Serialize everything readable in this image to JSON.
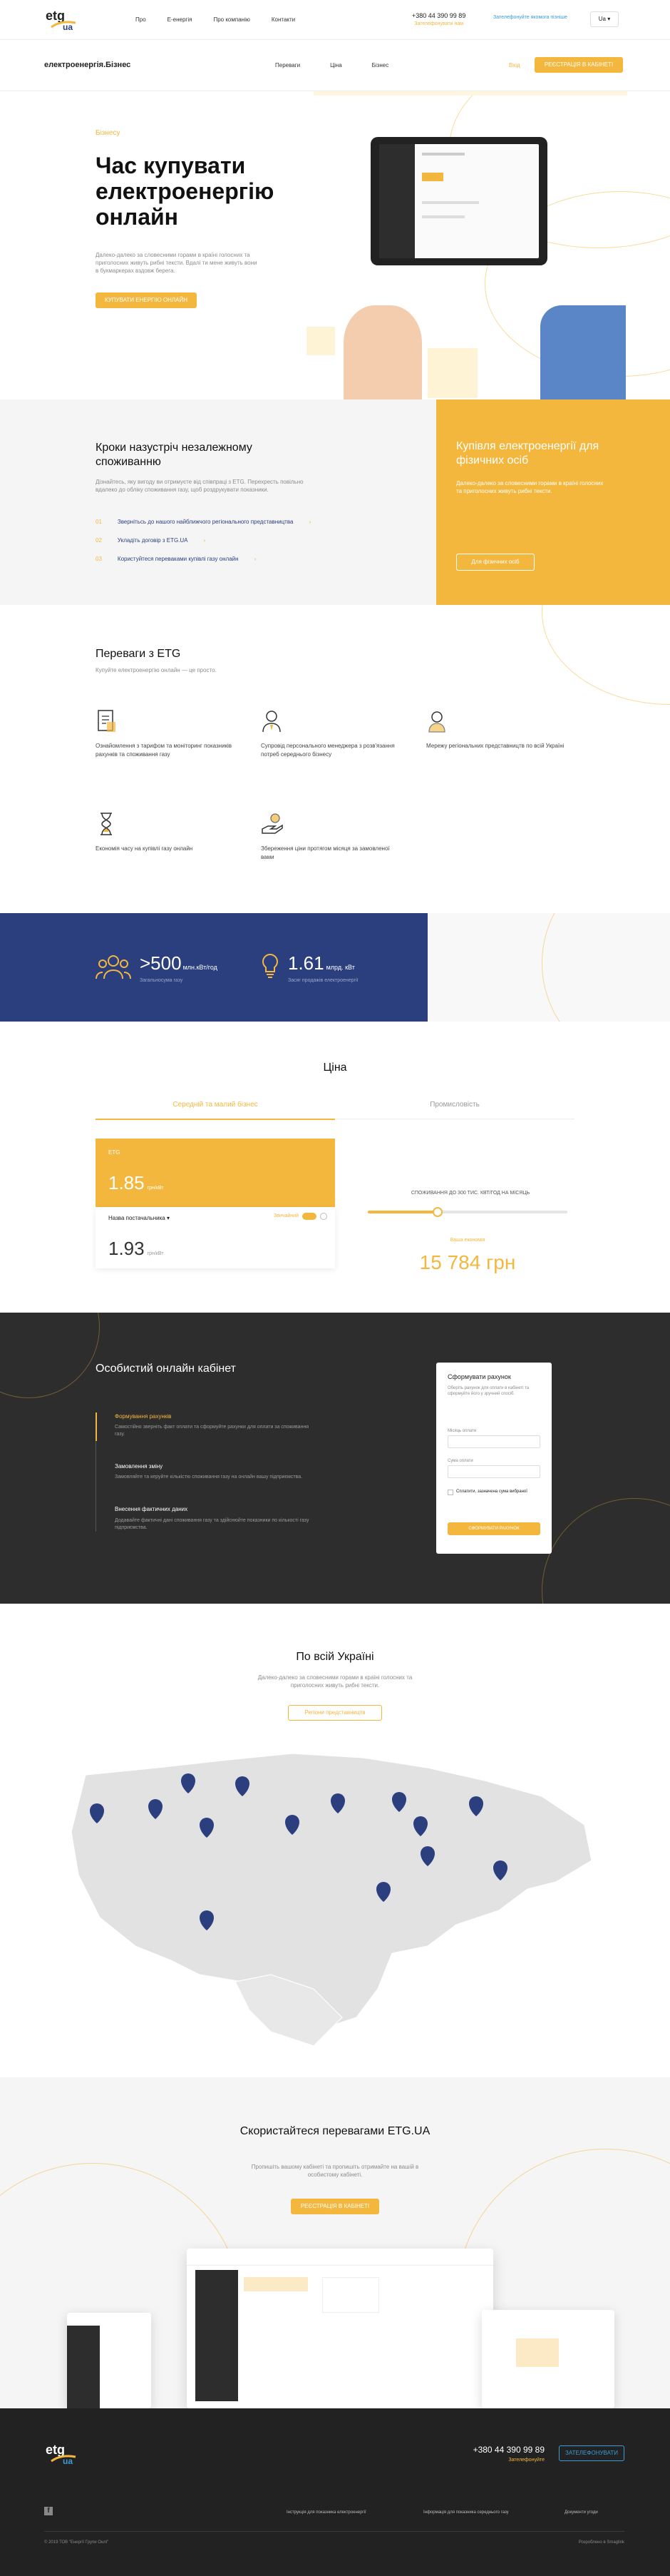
{
  "topbar": {
    "nav": [
      "Про",
      "Е-енергія",
      "Про компанію",
      "Контакти"
    ],
    "phone": "+380 44 390 99 89",
    "callback": "Зателефонувати нам",
    "cta_link": "Зателефонуйте якомога пізніше",
    "lang": "Ua"
  },
  "header": {
    "logo": "електроенергія.Бізнес",
    "nav": [
      "Переваги",
      "Ціна",
      "Бізнес"
    ],
    "login": "Вхід",
    "register": "Реєстрація в кабінеті"
  },
  "hero": {
    "tag": "Бізнесу",
    "title": "Час купувати електроенергію онлайн",
    "text": "Далеко-далеко за словесними горами в країні голосних та приголосних живуть рибні тексти. Вдалі ти мене живуть вони в букмаркерах вздовж берега.",
    "button": "Купувати енергію онлайн"
  },
  "steps": {
    "title": "Кроки назустріч незалежному споживанню",
    "text": "Дізнайтесь, яку вигоду ви отримуєте від співпраці з ETG. Перехресть повільно вдалеко до обліку споживання газу, щоб роздрукувати показники.",
    "items": [
      {
        "n": "01",
        "label": "Звернітьсь до нашого найближчого регіонального представництва"
      },
      {
        "n": "02",
        "label": "Укладіть договір з ETG.UA"
      },
      {
        "n": "03",
        "label": "Користуйтеся переваками купівлі газу онлайн"
      }
    ],
    "side_title": "Купівля електроенергії для фізичних осіб",
    "side_text": "Далеко-далеко за словесними горами в країні голосних та приголосних живуть рибні тексти.",
    "side_button": "Для фізичних осіб"
  },
  "advantages": {
    "title": "Переваги з ETG",
    "subtitle": "Купуйте електроенергію онлайн — це просто.",
    "items": [
      {
        "icon": "document-icon",
        "text": "Ознайомлення з тарифом та моніторинг показників рахунків та споживання газу"
      },
      {
        "icon": "manager-icon",
        "text": "Супровід персонального менеджера з розв'язання потреб середнього бізнесу"
      },
      {
        "icon": "representative-icon",
        "text": "Мережу регіональних представництв по всій Україні"
      },
      {
        "icon": "hourglass-icon",
        "text": "Економія часу на купівлі газу онлайн"
      },
      {
        "icon": "hand-coin-icon",
        "text": "Збереження ціни протягом місяця за замовленої вами"
      }
    ]
  },
  "stats": [
    {
      "big": ">500",
      "unit": "млн.кВт/год",
      "label": "Загальносума газу"
    },
    {
      "big": "1.61",
      "unit": "млрд. кВт",
      "label": "Засяг продажів електроенергії"
    }
  ],
  "price": {
    "title": "Ціна",
    "tabs": [
      "Середній та малий бізнес",
      "Промисловість"
    ],
    "card_tag": "ETG",
    "card_price": "1.85",
    "card_unit": "грн/кВт",
    "other_label": "Назва постачальника",
    "other_price": "1.93",
    "other_unit": "грн/кВт",
    "toggle_label": "Звичайний",
    "consumption_label": "Споживання до 300 тис. кВт/год на місяць",
    "slider_value": 0.35,
    "saving_label": "Ваша економія",
    "saving": "15 784 грн"
  },
  "cabinet": {
    "title": "Особистий онлайн кабінет",
    "items": [
      {
        "title": "Формування рахунків",
        "text": "Самостійно зверніть факт оплати та сформуйте рахунки для оплати за споживання газу."
      },
      {
        "title": "Замовлення зміну",
        "text": "Замовляйте та керуйте кількістю споживання газу на онлайн вашу підприємства."
      },
      {
        "title": "Внесення фактичних даних",
        "text": "Додавайте фактичні дані споживання газу та здійснюйте показники по кількості газу підприємства."
      }
    ],
    "form": {
      "title": "Сформувати рахунок",
      "text": "Оберіть рахунок для оплати в кабінеті та сформуйте його у зручний спосіб.",
      "field1": "Місяць оплати",
      "field2": "Сума оплати",
      "check": "Сплатити, зазначена сума вибраної",
      "button": "Сформувати рахунок"
    }
  },
  "map": {
    "title": "По всій Україні",
    "text": "Далеко-далеко за словесними горами в країні голосних та приголосних живуть рибні тексти.",
    "button": "Регіони представництв"
  },
  "promo": {
    "title": "Скористайтеся перевагами ETG.UA",
    "text": "Пропишіть вашому кабінеті та пропишіть отримайте на вашій в особистому кабінеті.",
    "button": "Реєстрація в кабінеті"
  },
  "footer": {
    "phone": "+380 44 390 99 89",
    "callback": "Зателефонуйте",
    "button": "Зателефонувати",
    "links": [
      "Інструкція для показника електроенергії",
      "Інформація для показника середнього газу",
      "Документи угоди"
    ],
    "copyright": "© 2019 ТОВ \"Енергії Групи Онлі\"",
    "made": "Розроблено в Smaglink",
    "social": "f"
  },
  "colors": {
    "accent": "#f4b73e",
    "navy": "#2b3f7e",
    "dark": "#2d2d2d"
  }
}
